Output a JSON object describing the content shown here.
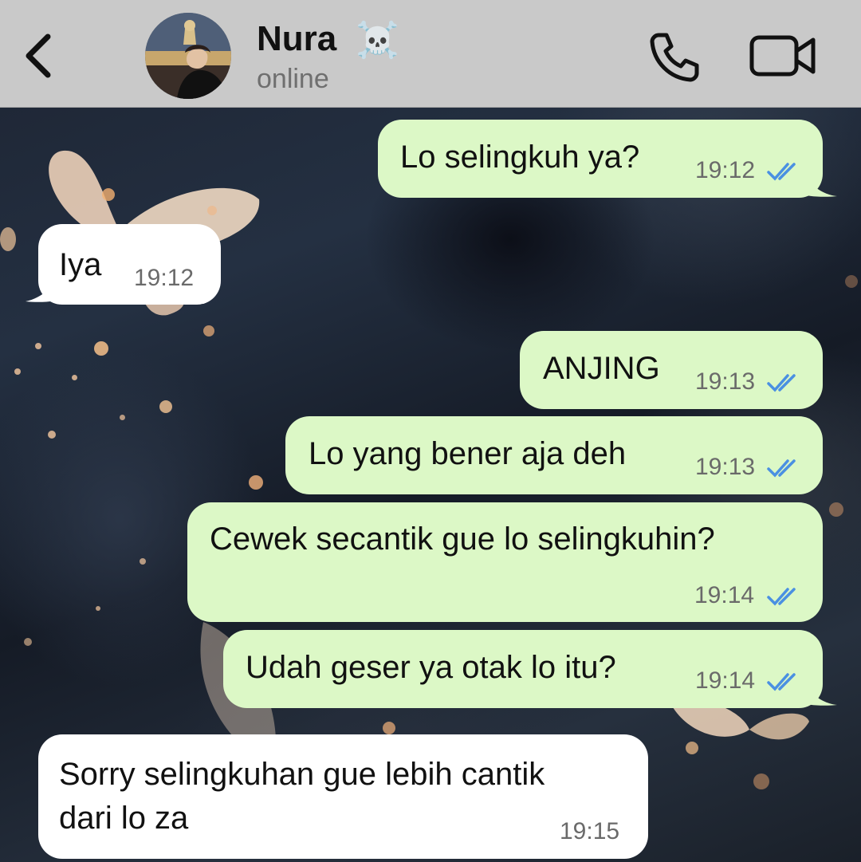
{
  "header": {
    "contact_name": "Nura",
    "contact_emoji": "☠️",
    "status": "online",
    "icons": [
      "back-chevron-icon",
      "voice-call-icon",
      "video-call-icon"
    ]
  },
  "messages": [
    {
      "direction": "outgoing",
      "text": "Lo selingkuh ya?",
      "time": "19:12",
      "read": true
    },
    {
      "direction": "incoming",
      "text": "Iya",
      "time": "19:12"
    },
    {
      "direction": "outgoing",
      "text": "ANJING",
      "time": "19:13",
      "read": true
    },
    {
      "direction": "outgoing",
      "text": "Lo yang bener aja deh",
      "time": "19:13",
      "read": true
    },
    {
      "direction": "outgoing",
      "text": "Cewek secantik gue lo selingkuhin?",
      "time": "19:14",
      "read": true
    },
    {
      "direction": "outgoing",
      "text": "Udah geser ya otak lo itu?",
      "time": "19:14",
      "read": true
    },
    {
      "direction": "incoming",
      "text_line1": "Sorry selingkuhan gue lebih cantik",
      "text_line2": "dari lo za",
      "time": "19:15"
    }
  ],
  "colors": {
    "outgoing_bubble": "#dcf8c6",
    "incoming_bubble": "#ffffff",
    "read_ticks": "#4a90e2",
    "header_bg": "#c9c9c9"
  }
}
